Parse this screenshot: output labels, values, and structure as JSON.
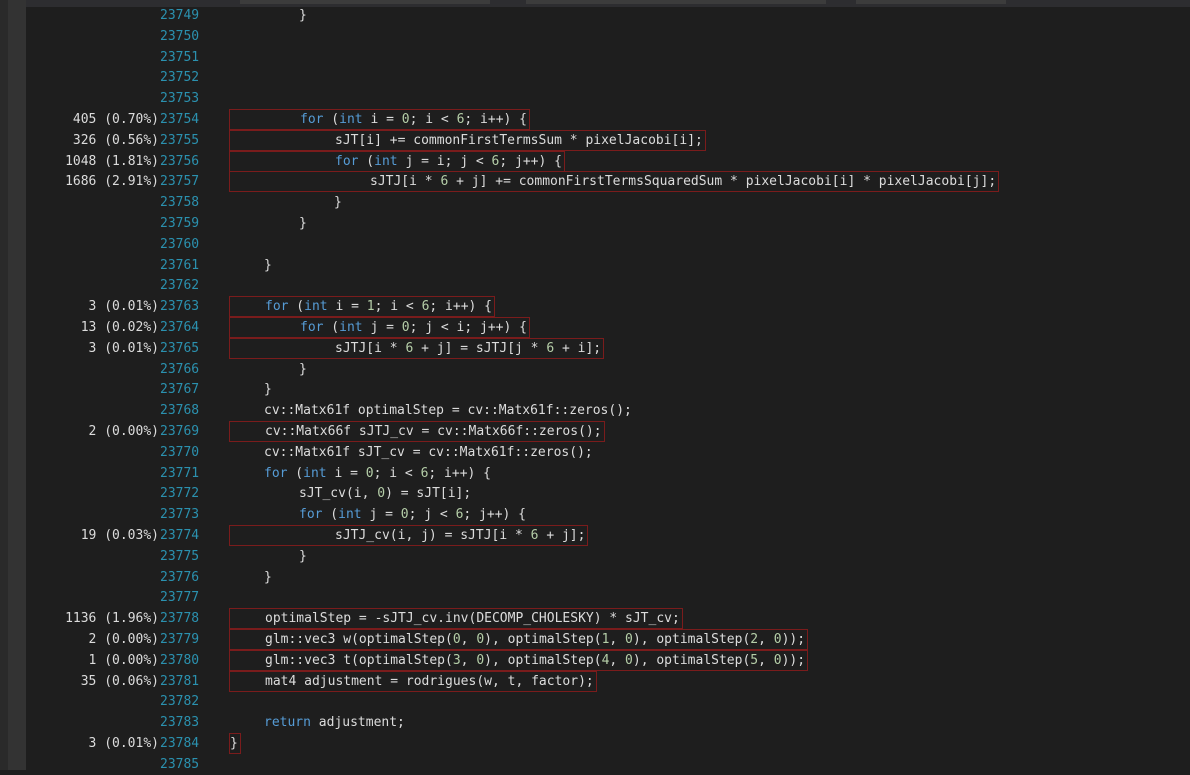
{
  "colors": {
    "background": "#1e1e1e",
    "line_number": "#2b91af",
    "keyword": "#569cd6",
    "number": "#b5cea8",
    "text": "#dcdcdc",
    "hot_border": "#7a1c1c"
  },
  "lines": [
    {
      "n": "23749",
      "hits": "",
      "indent": 2,
      "hot": false,
      "tokens": [
        [
          "}",
          "p"
        ]
      ]
    },
    {
      "n": "23750",
      "hits": "",
      "indent": 0,
      "hot": false,
      "tokens": []
    },
    {
      "n": "23751",
      "hits": "",
      "indent": 0,
      "hot": false,
      "tokens": []
    },
    {
      "n": "23752",
      "hits": "",
      "indent": 0,
      "hot": false,
      "tokens": []
    },
    {
      "n": "23753",
      "hits": "",
      "indent": 0,
      "hot": false,
      "tokens": []
    },
    {
      "n": "23754",
      "hits": "405 (0.70%)",
      "indent": 2,
      "hot": true,
      "tokens": [
        [
          "for",
          "k"
        ],
        [
          " (",
          "p"
        ],
        [
          "int",
          "k"
        ],
        [
          " i = ",
          "p"
        ],
        [
          "0",
          "n"
        ],
        [
          "; i < ",
          "p"
        ],
        [
          "6",
          "n"
        ],
        [
          "; i++) {",
          "p"
        ]
      ]
    },
    {
      "n": "23755",
      "hits": "326 (0.56%)",
      "indent": 3,
      "hot": true,
      "tokens": [
        [
          "sJT[i] += commonFirstTermsSum * pixelJacobi[i];",
          "p"
        ]
      ]
    },
    {
      "n": "23756",
      "hits": "1048 (1.81%)",
      "indent": 3,
      "hot": true,
      "tokens": [
        [
          "for",
          "k"
        ],
        [
          " (",
          "p"
        ],
        [
          "int",
          "k"
        ],
        [
          " j = i; j < ",
          "p"
        ],
        [
          "6",
          "n"
        ],
        [
          "; j++) {",
          "p"
        ]
      ]
    },
    {
      "n": "23757",
      "hits": "1686 (2.91%)",
      "indent": 4,
      "hot": true,
      "tokens": [
        [
          "sJTJ[i * ",
          "p"
        ],
        [
          "6",
          "n"
        ],
        [
          " + j] += commonFirstTermsSquaredSum * pixelJacobi[i] * pixelJacobi[j];",
          "p"
        ]
      ]
    },
    {
      "n": "23758",
      "hits": "",
      "indent": 3,
      "hot": false,
      "tokens": [
        [
          "}",
          "p"
        ]
      ]
    },
    {
      "n": "23759",
      "hits": "",
      "indent": 2,
      "hot": false,
      "tokens": [
        [
          "}",
          "p"
        ]
      ]
    },
    {
      "n": "23760",
      "hits": "",
      "indent": 0,
      "hot": false,
      "tokens": []
    },
    {
      "n": "23761",
      "hits": "",
      "indent": 1,
      "hot": false,
      "tokens": [
        [
          "}",
          "p"
        ]
      ]
    },
    {
      "n": "23762",
      "hits": "",
      "indent": 0,
      "hot": false,
      "tokens": []
    },
    {
      "n": "23763",
      "hits": "3 (0.01%)",
      "indent": 1,
      "hot": true,
      "tokens": [
        [
          "for",
          "k"
        ],
        [
          " (",
          "p"
        ],
        [
          "int",
          "k"
        ],
        [
          " i = ",
          "p"
        ],
        [
          "1",
          "n"
        ],
        [
          "; i < ",
          "p"
        ],
        [
          "6",
          "n"
        ],
        [
          "; i++) {",
          "p"
        ]
      ]
    },
    {
      "n": "23764",
      "hits": "13 (0.02%)",
      "indent": 2,
      "hot": true,
      "tokens": [
        [
          "for",
          "k"
        ],
        [
          " (",
          "p"
        ],
        [
          "int",
          "k"
        ],
        [
          " j = ",
          "p"
        ],
        [
          "0",
          "n"
        ],
        [
          "; j < i; j++) {",
          "p"
        ]
      ]
    },
    {
      "n": "23765",
      "hits": "3 (0.01%)",
      "indent": 3,
      "hot": true,
      "tokens": [
        [
          "sJTJ[i * ",
          "p"
        ],
        [
          "6",
          "n"
        ],
        [
          " + j] = sJTJ[j * ",
          "p"
        ],
        [
          "6",
          "n"
        ],
        [
          " + i];",
          "p"
        ]
      ]
    },
    {
      "n": "23766",
      "hits": "",
      "indent": 2,
      "hot": false,
      "tokens": [
        [
          "}",
          "p"
        ]
      ]
    },
    {
      "n": "23767",
      "hits": "",
      "indent": 1,
      "hot": false,
      "tokens": [
        [
          "}",
          "p"
        ]
      ]
    },
    {
      "n": "23768",
      "hits": "",
      "indent": 1,
      "hot": false,
      "tokens": [
        [
          "cv::Matx61f optimalStep = cv::Matx61f::zeros();",
          "p"
        ]
      ]
    },
    {
      "n": "23769",
      "hits": "2 (0.00%)",
      "indent": 1,
      "hot": true,
      "tokens": [
        [
          "cv::Matx66f sJTJ_cv = cv::Matx66f::zeros();",
          "p"
        ]
      ]
    },
    {
      "n": "23770",
      "hits": "",
      "indent": 1,
      "hot": false,
      "tokens": [
        [
          "cv::Matx61f sJT_cv = cv::Matx61f::zeros();",
          "p"
        ]
      ]
    },
    {
      "n": "23771",
      "hits": "",
      "indent": 1,
      "hot": false,
      "tokens": [
        [
          "for",
          "k"
        ],
        [
          " (",
          "p"
        ],
        [
          "int",
          "k"
        ],
        [
          " i = ",
          "p"
        ],
        [
          "0",
          "n"
        ],
        [
          "; i < ",
          "p"
        ],
        [
          "6",
          "n"
        ],
        [
          "; i++) {",
          "p"
        ]
      ]
    },
    {
      "n": "23772",
      "hits": "",
      "indent": 2,
      "hot": false,
      "tokens": [
        [
          "sJT_cv(i, ",
          "p"
        ],
        [
          "0",
          "n"
        ],
        [
          ") = sJT[i];",
          "p"
        ]
      ]
    },
    {
      "n": "23773",
      "hits": "",
      "indent": 2,
      "hot": false,
      "tokens": [
        [
          "for",
          "k"
        ],
        [
          " (",
          "p"
        ],
        [
          "int",
          "k"
        ],
        [
          " j = ",
          "p"
        ],
        [
          "0",
          "n"
        ],
        [
          "; j < ",
          "p"
        ],
        [
          "6",
          "n"
        ],
        [
          "; j++) {",
          "p"
        ]
      ]
    },
    {
      "n": "23774",
      "hits": "19 (0.03%)",
      "indent": 3,
      "hot": true,
      "tokens": [
        [
          "sJTJ_cv(i, j) = sJTJ[i * ",
          "p"
        ],
        [
          "6",
          "n"
        ],
        [
          " + j];",
          "p"
        ]
      ]
    },
    {
      "n": "23775",
      "hits": "",
      "indent": 2,
      "hot": false,
      "tokens": [
        [
          "}",
          "p"
        ]
      ]
    },
    {
      "n": "23776",
      "hits": "",
      "indent": 1,
      "hot": false,
      "tokens": [
        [
          "}",
          "p"
        ]
      ]
    },
    {
      "n": "23777",
      "hits": "",
      "indent": 0,
      "hot": false,
      "tokens": []
    },
    {
      "n": "23778",
      "hits": "1136 (1.96%)",
      "indent": 1,
      "hot": true,
      "tokens": [
        [
          "optimalStep = -sJTJ_cv.inv(DECOMP_CHOLESKY) * sJT_cv;",
          "p"
        ]
      ]
    },
    {
      "n": "23779",
      "hits": "2 (0.00%)",
      "indent": 1,
      "hot": true,
      "tokens": [
        [
          "glm::vec3 w(optimalStep(",
          "p"
        ],
        [
          "0",
          "n"
        ],
        [
          ", ",
          "p"
        ],
        [
          "0",
          "n"
        ],
        [
          "), optimalStep(",
          "p"
        ],
        [
          "1",
          "n"
        ],
        [
          ", ",
          "p"
        ],
        [
          "0",
          "n"
        ],
        [
          "), optimalStep(",
          "p"
        ],
        [
          "2",
          "n"
        ],
        [
          ", ",
          "p"
        ],
        [
          "0",
          "n"
        ],
        [
          "));",
          "p"
        ]
      ]
    },
    {
      "n": "23780",
      "hits": "1 (0.00%)",
      "indent": 1,
      "hot": true,
      "tokens": [
        [
          "glm::vec3 t(optimalStep(",
          "p"
        ],
        [
          "3",
          "n"
        ],
        [
          ", ",
          "p"
        ],
        [
          "0",
          "n"
        ],
        [
          "), optimalStep(",
          "p"
        ],
        [
          "4",
          "n"
        ],
        [
          ", ",
          "p"
        ],
        [
          "0",
          "n"
        ],
        [
          "), optimalStep(",
          "p"
        ],
        [
          "5",
          "n"
        ],
        [
          ", ",
          "p"
        ],
        [
          "0",
          "n"
        ],
        [
          "));",
          "p"
        ]
      ]
    },
    {
      "n": "23781",
      "hits": "35 (0.06%)",
      "indent": 1,
      "hot": true,
      "tokens": [
        [
          "mat4 adjustment = rodrigues(w, t, factor);",
          "p"
        ]
      ]
    },
    {
      "n": "23782",
      "hits": "",
      "indent": 0,
      "hot": false,
      "tokens": []
    },
    {
      "n": "23783",
      "hits": "",
      "indent": 1,
      "hot": false,
      "tokens": [
        [
          "return",
          "k"
        ],
        [
          " adjustment;",
          "p"
        ]
      ]
    },
    {
      "n": "23784",
      "hits": "3 (0.01%)",
      "indent": 0,
      "hot": true,
      "tokens": [
        [
          "}",
          "p"
        ]
      ]
    },
    {
      "n": "23785",
      "hits": "",
      "indent": 0,
      "hot": false,
      "tokens": []
    }
  ]
}
